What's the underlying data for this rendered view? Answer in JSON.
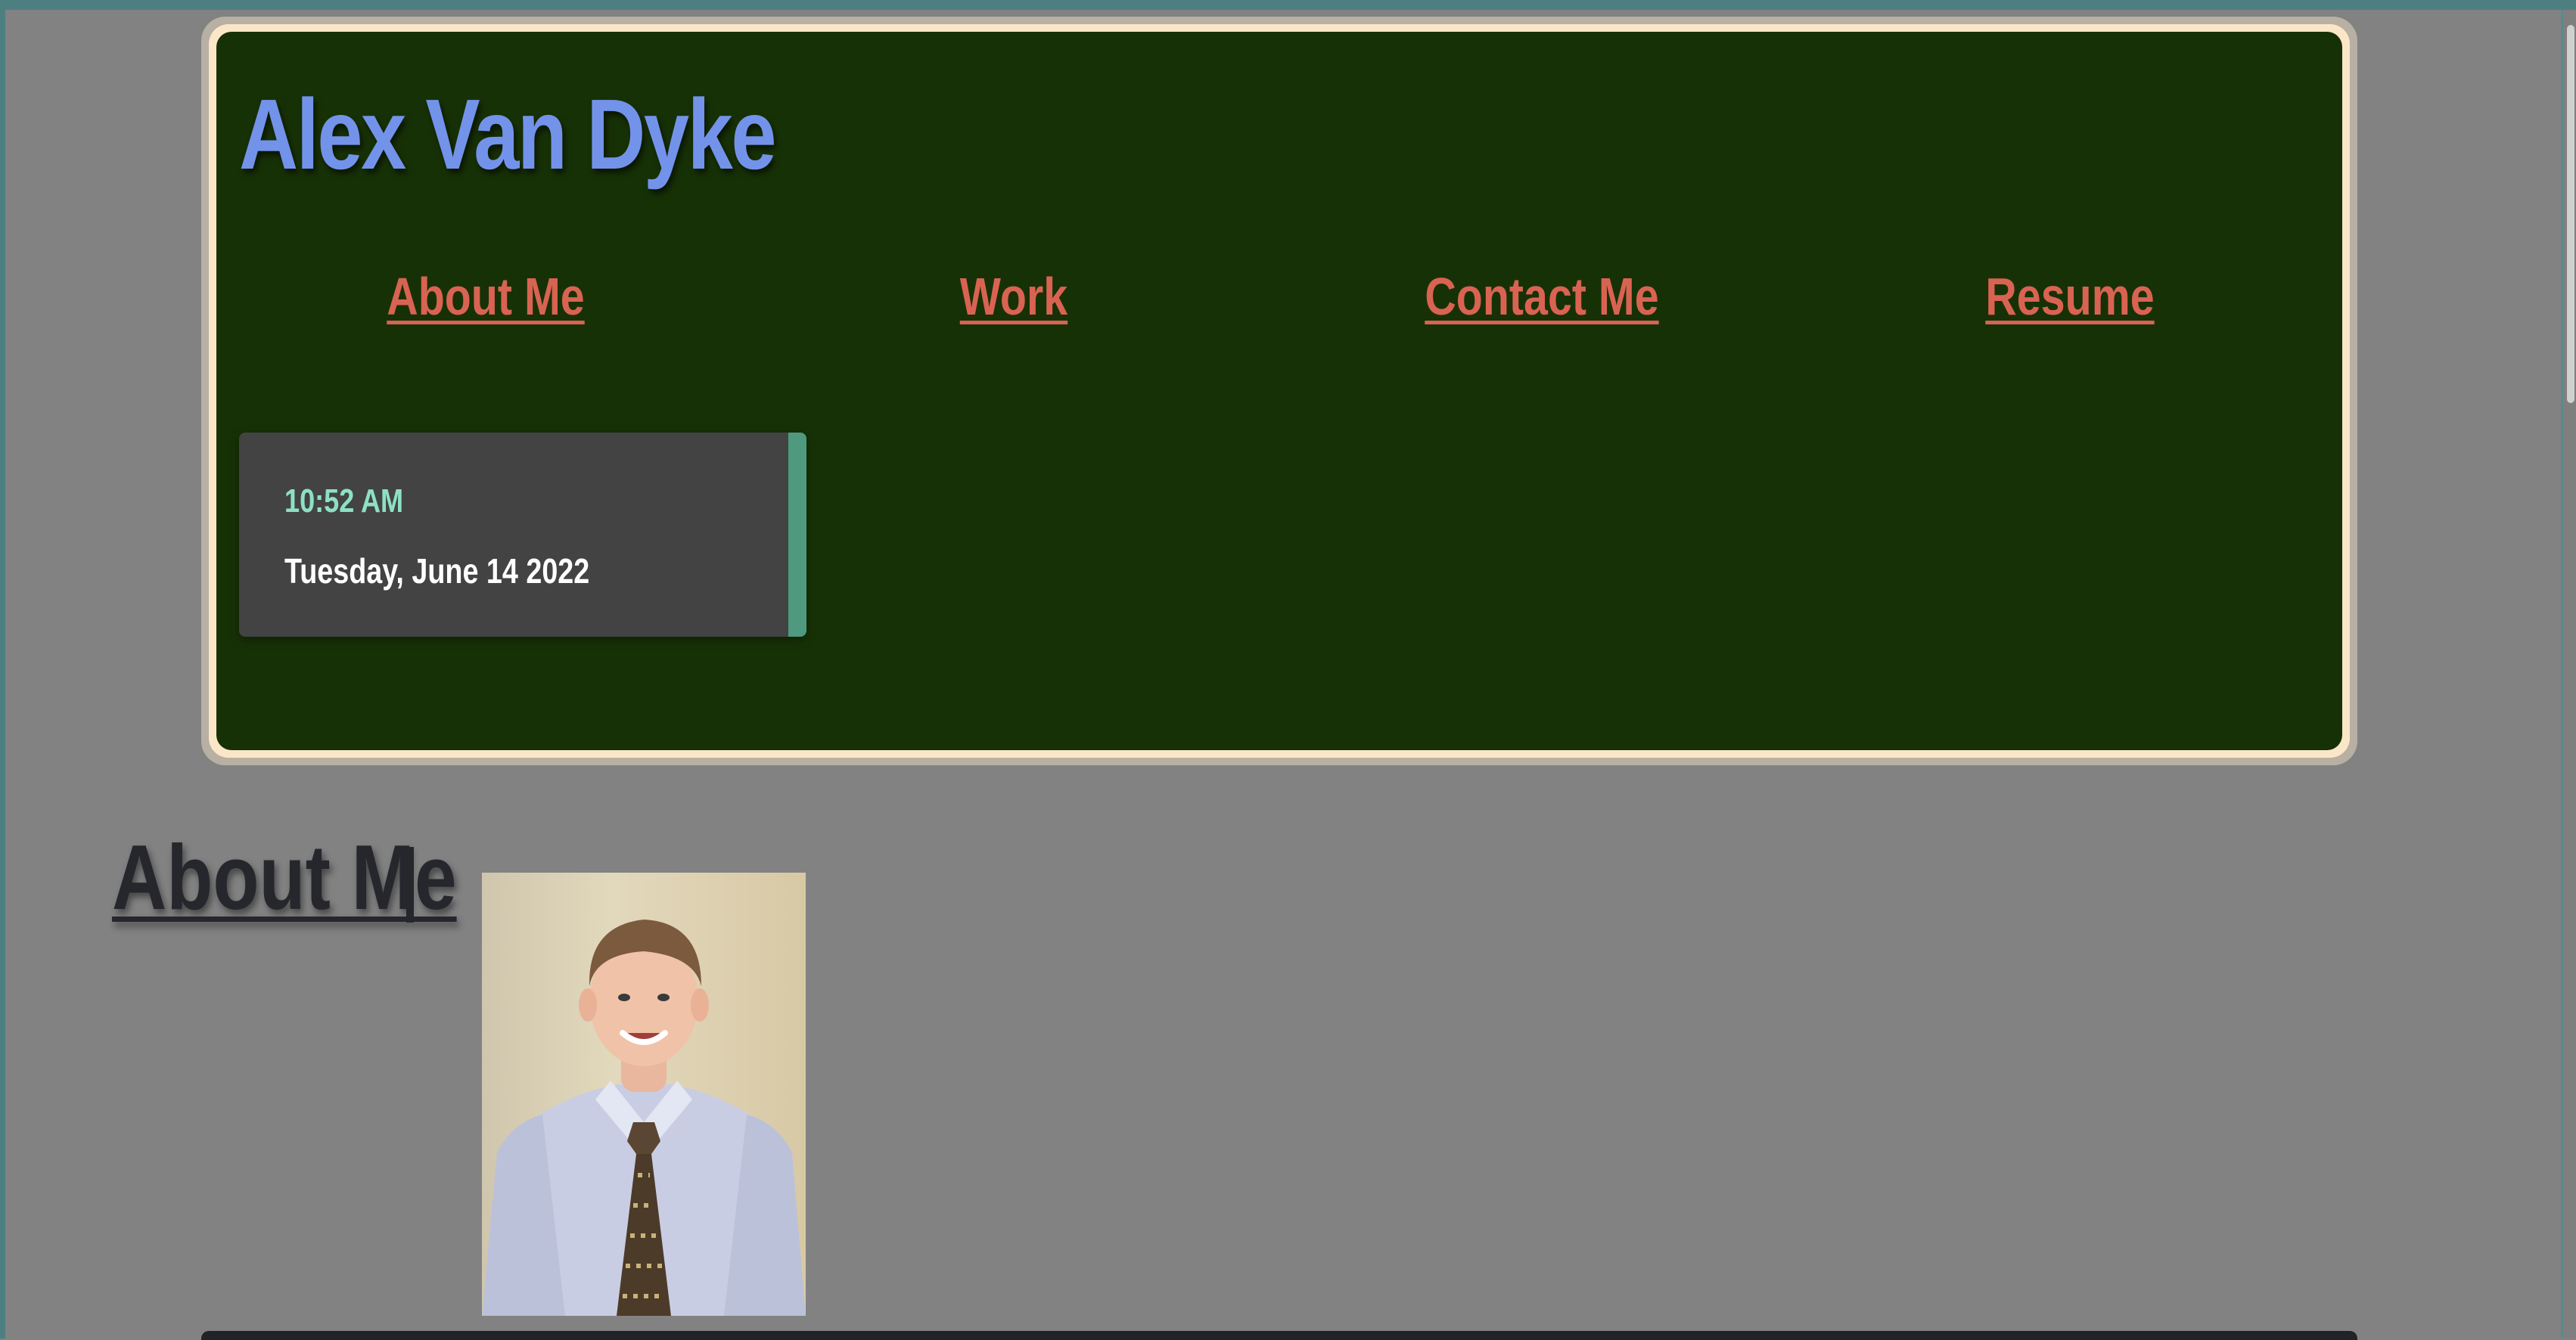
{
  "header": {
    "site_title": "Alex Van Dyke",
    "nav": [
      {
        "label": "About Me"
      },
      {
        "label": "Work"
      },
      {
        "label": "Contact Me"
      },
      {
        "label": "Resume"
      }
    ]
  },
  "datetime": {
    "time": "10:52 AM",
    "date": "Tuesday, June 14 2022"
  },
  "about": {
    "heading": "About Me"
  },
  "colors": {
    "page_background": "#828282",
    "header_background": "#173106",
    "header_border": "#fbe7c8",
    "title_color": "#7393ea",
    "nav_color": "#d96352",
    "datetime_card": "#434343",
    "datetime_accent": "#4f9a7e",
    "time_color": "#8ee0c5",
    "heading_color": "#26272d"
  }
}
